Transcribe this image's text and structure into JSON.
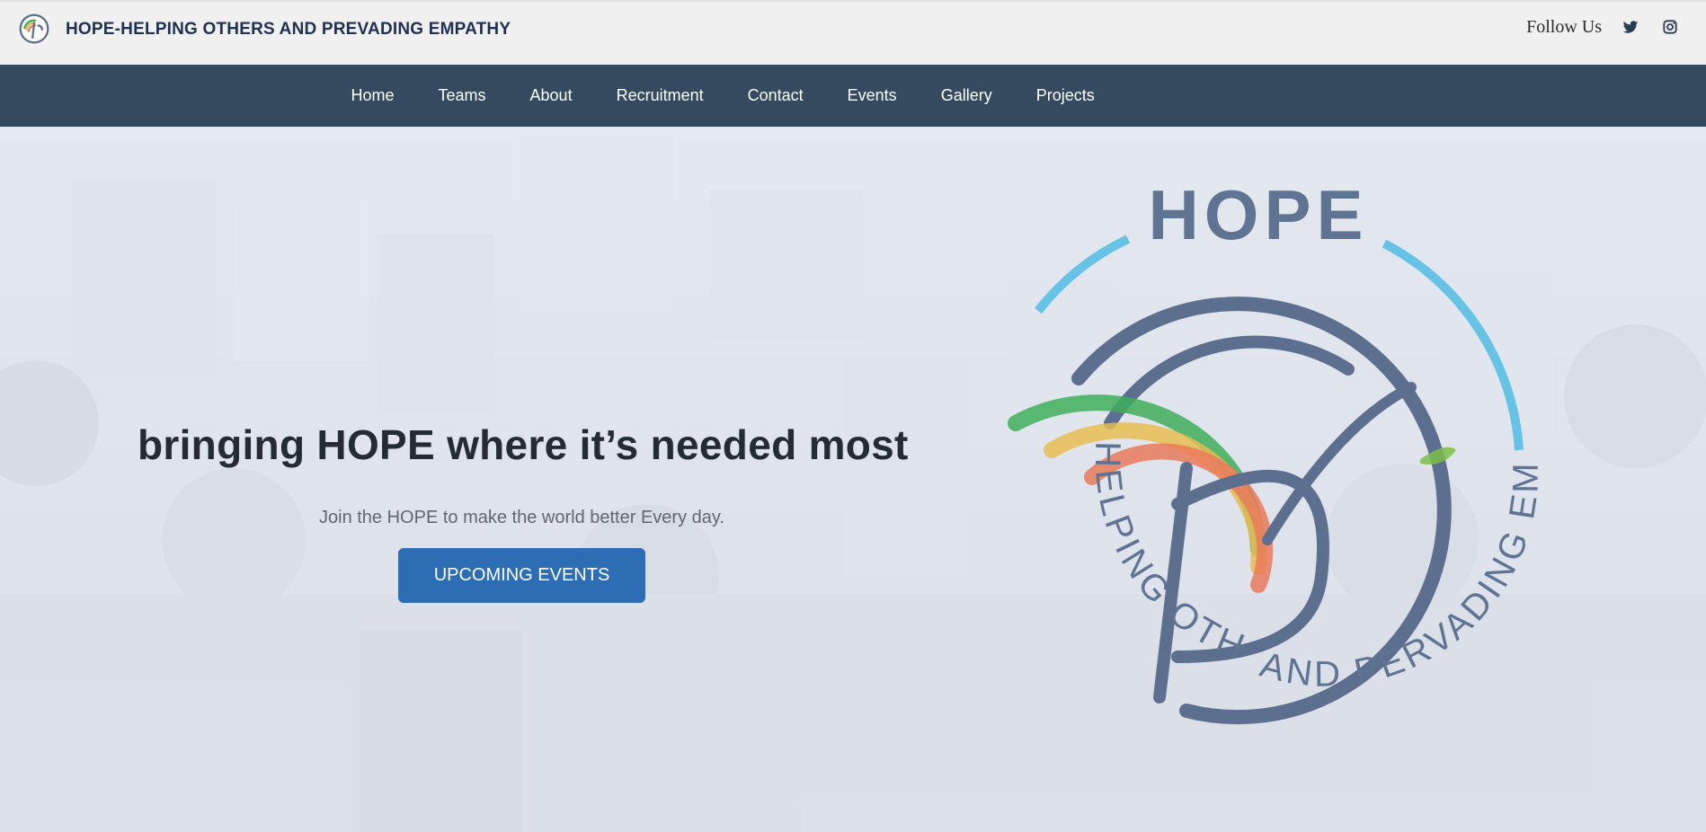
{
  "header": {
    "title": "HOPE-HELPING OTHERS AND PREVADING EMPATHY",
    "follow_label": "Follow Us",
    "social": [
      {
        "name": "twitter-icon"
      },
      {
        "name": "instagram-icon"
      }
    ]
  },
  "nav": {
    "items": [
      "Home",
      "Teams",
      "About",
      "Recruitment",
      "Contact",
      "Events",
      "Gallery",
      "Projects"
    ]
  },
  "hero": {
    "heading": "bringing HOPE where it’s needed most",
    "subheading": "Join the HOPE to make the world better Every day.",
    "cta_label": "UPCOMING EVENTS",
    "logo": {
      "word": "HOPE",
      "left_arc_text": "HELPING OTHERS",
      "right_arc_text": "AND PERVADING EMPATHY"
    }
  },
  "colors": {
    "nav_bg": "#354a5f",
    "topbar_bg": "#f0f0f1",
    "cta_bg": "#2d6db3",
    "brand_text": "#1f3150"
  }
}
